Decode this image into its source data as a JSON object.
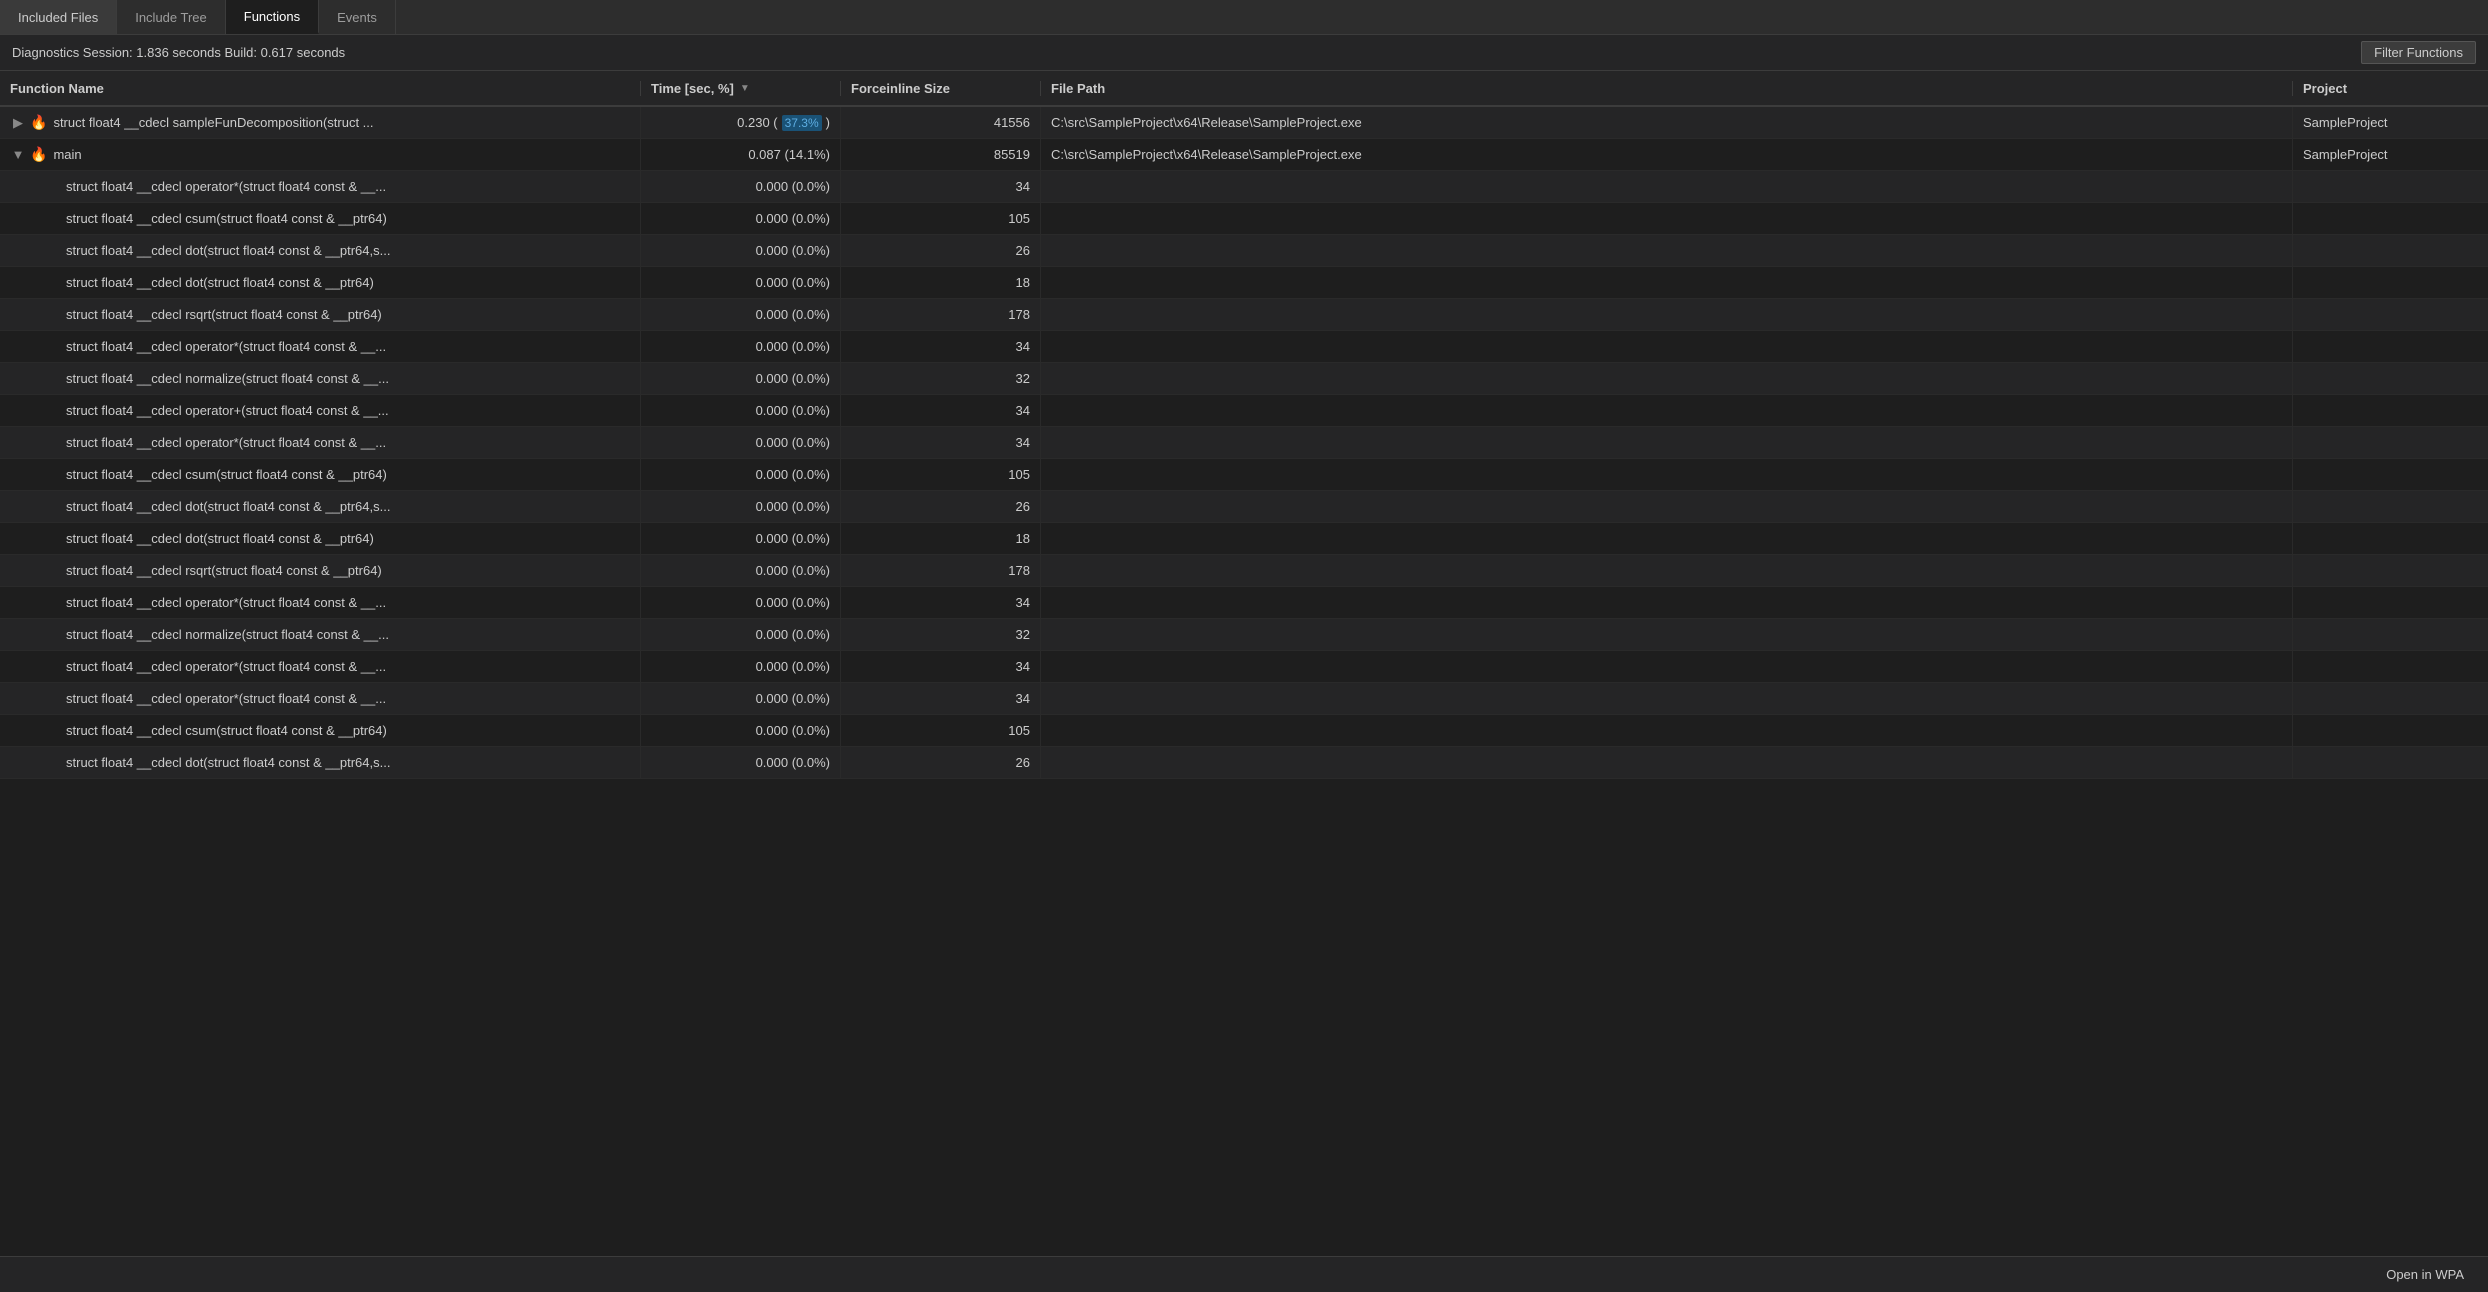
{
  "tabs": [
    {
      "id": "included-files",
      "label": "Included Files",
      "active": false
    },
    {
      "id": "include-tree",
      "label": "Include Tree",
      "active": false
    },
    {
      "id": "functions",
      "label": "Functions",
      "active": true
    },
    {
      "id": "events",
      "label": "Events",
      "active": false
    }
  ],
  "status": {
    "text": "Diagnostics Session: 1.836 seconds  Build: 0.617 seconds"
  },
  "filter_button_label": "Filter Functions",
  "columns": {
    "function_name": "Function Name",
    "time": "Time [sec, %]",
    "forceinline_size": "Forceinline Size",
    "file_path": "File Path",
    "project": "Project"
  },
  "rows": [
    {
      "level": 0,
      "expandable": true,
      "expanded": false,
      "has_flame": true,
      "indent": 0,
      "name": "struct float4 __cdecl sampleFunDecomposition(struct ...",
      "time_val": "0.230",
      "time_pct": "37.3%",
      "time_pct_highlight": true,
      "forceinline": "41556",
      "file_path": "C:\\src\\SampleProject\\x64\\Release\\SampleProject.exe",
      "project": "SampleProject"
    },
    {
      "level": 0,
      "expandable": true,
      "expanded": true,
      "has_flame": true,
      "indent": 0,
      "name": "main",
      "time_val": "0.087",
      "time_pct": "14.1%",
      "time_pct_highlight": false,
      "forceinline": "85519",
      "file_path": "C:\\src\\SampleProject\\x64\\Release\\SampleProject.exe",
      "project": "SampleProject"
    },
    {
      "level": 1,
      "expandable": false,
      "expanded": false,
      "has_flame": false,
      "indent": 36,
      "name": "struct float4 __cdecl operator*(struct float4 const & __...",
      "time_val": "0.000",
      "time_pct": "0.0%",
      "time_pct_highlight": false,
      "forceinline": "34",
      "file_path": "",
      "project": ""
    },
    {
      "level": 1,
      "expandable": false,
      "expanded": false,
      "has_flame": false,
      "indent": 36,
      "name": "struct float4 __cdecl csum(struct float4 const & __ptr64)",
      "time_val": "0.000",
      "time_pct": "0.0%",
      "time_pct_highlight": false,
      "forceinline": "105",
      "file_path": "",
      "project": ""
    },
    {
      "level": 1,
      "expandable": false,
      "expanded": false,
      "has_flame": false,
      "indent": 36,
      "name": "struct float4 __cdecl dot(struct float4 const & __ptr64,s...",
      "time_val": "0.000",
      "time_pct": "0.0%",
      "time_pct_highlight": false,
      "forceinline": "26",
      "file_path": "",
      "project": ""
    },
    {
      "level": 1,
      "expandable": false,
      "expanded": false,
      "has_flame": false,
      "indent": 36,
      "name": "struct float4 __cdecl dot(struct float4 const & __ptr64)",
      "time_val": "0.000",
      "time_pct": "0.0%",
      "time_pct_highlight": false,
      "forceinline": "18",
      "file_path": "",
      "project": ""
    },
    {
      "level": 1,
      "expandable": false,
      "expanded": false,
      "has_flame": false,
      "indent": 36,
      "name": "struct float4 __cdecl rsqrt(struct float4 const & __ptr64)",
      "time_val": "0.000",
      "time_pct": "0.0%",
      "time_pct_highlight": false,
      "forceinline": "178",
      "file_path": "",
      "project": ""
    },
    {
      "level": 1,
      "expandable": false,
      "expanded": false,
      "has_flame": false,
      "indent": 36,
      "name": "struct float4 __cdecl operator*(struct float4 const & __...",
      "time_val": "0.000",
      "time_pct": "0.0%",
      "time_pct_highlight": false,
      "forceinline": "34",
      "file_path": "",
      "project": ""
    },
    {
      "level": 1,
      "expandable": false,
      "expanded": false,
      "has_flame": false,
      "indent": 36,
      "name": "struct float4 __cdecl normalize(struct float4 const & __...",
      "time_val": "0.000",
      "time_pct": "0.0%",
      "time_pct_highlight": false,
      "forceinline": "32",
      "file_path": "",
      "project": ""
    },
    {
      "level": 1,
      "expandable": false,
      "expanded": false,
      "has_flame": false,
      "indent": 36,
      "name": "struct float4 __cdecl operator+(struct float4 const & __...",
      "time_val": "0.000",
      "time_pct": "0.0%",
      "time_pct_highlight": false,
      "forceinline": "34",
      "file_path": "",
      "project": ""
    },
    {
      "level": 1,
      "expandable": false,
      "expanded": false,
      "has_flame": false,
      "indent": 36,
      "name": "struct float4 __cdecl operator*(struct float4 const & __...",
      "time_val": "0.000",
      "time_pct": "0.0%",
      "time_pct_highlight": false,
      "forceinline": "34",
      "file_path": "",
      "project": ""
    },
    {
      "level": 1,
      "expandable": false,
      "expanded": false,
      "has_flame": false,
      "indent": 36,
      "name": "struct float4 __cdecl csum(struct float4 const & __ptr64)",
      "time_val": "0.000",
      "time_pct": "0.0%",
      "time_pct_highlight": false,
      "forceinline": "105",
      "file_path": "",
      "project": ""
    },
    {
      "level": 1,
      "expandable": false,
      "expanded": false,
      "has_flame": false,
      "indent": 36,
      "name": "struct float4 __cdecl dot(struct float4 const & __ptr64,s...",
      "time_val": "0.000",
      "time_pct": "0.0%",
      "time_pct_highlight": false,
      "forceinline": "26",
      "file_path": "",
      "project": ""
    },
    {
      "level": 1,
      "expandable": false,
      "expanded": false,
      "has_flame": false,
      "indent": 36,
      "name": "struct float4 __cdecl dot(struct float4 const & __ptr64)",
      "time_val": "0.000",
      "time_pct": "0.0%",
      "time_pct_highlight": false,
      "forceinline": "18",
      "file_path": "",
      "project": ""
    },
    {
      "level": 1,
      "expandable": false,
      "expanded": false,
      "has_flame": false,
      "indent": 36,
      "name": "struct float4 __cdecl rsqrt(struct float4 const & __ptr64)",
      "time_val": "0.000",
      "time_pct": "0.0%",
      "time_pct_highlight": false,
      "forceinline": "178",
      "file_path": "",
      "project": ""
    },
    {
      "level": 1,
      "expandable": false,
      "expanded": false,
      "has_flame": false,
      "indent": 36,
      "name": "struct float4 __cdecl operator*(struct float4 const & __...",
      "time_val": "0.000",
      "time_pct": "0.0%",
      "time_pct_highlight": false,
      "forceinline": "34",
      "file_path": "",
      "project": ""
    },
    {
      "level": 1,
      "expandable": false,
      "expanded": false,
      "has_flame": false,
      "indent": 36,
      "name": "struct float4 __cdecl normalize(struct float4 const & __...",
      "time_val": "0.000",
      "time_pct": "0.0%",
      "time_pct_highlight": false,
      "forceinline": "32",
      "file_path": "",
      "project": ""
    },
    {
      "level": 1,
      "expandable": false,
      "expanded": false,
      "has_flame": false,
      "indent": 36,
      "name": "struct float4 __cdecl operator*(struct float4 const & __...",
      "time_val": "0.000",
      "time_pct": "0.0%",
      "time_pct_highlight": false,
      "forceinline": "34",
      "file_path": "",
      "project": ""
    },
    {
      "level": 1,
      "expandable": false,
      "expanded": false,
      "has_flame": false,
      "indent": 36,
      "name": "struct float4 __cdecl operator*(struct float4 const & __...",
      "time_val": "0.000",
      "time_pct": "0.0%",
      "time_pct_highlight": false,
      "forceinline": "34",
      "file_path": "",
      "project": ""
    },
    {
      "level": 1,
      "expandable": false,
      "expanded": false,
      "has_flame": false,
      "indent": 36,
      "name": "struct float4 __cdecl csum(struct float4 const & __ptr64)",
      "time_val": "0.000",
      "time_pct": "0.0%",
      "time_pct_highlight": false,
      "forceinline": "105",
      "file_path": "",
      "project": ""
    },
    {
      "level": 1,
      "expandable": false,
      "expanded": false,
      "has_flame": false,
      "indent": 36,
      "name": "struct float4 __cdecl dot(struct float4 const & __ptr64,s...",
      "time_val": "0.000",
      "time_pct": "0.0%",
      "time_pct_highlight": false,
      "forceinline": "26",
      "file_path": "",
      "project": ""
    }
  ],
  "bottom_bar": {
    "open_wpa_label": "Open in WPA"
  },
  "colors": {
    "active_tab_bg": "#1e1e1e",
    "inactive_tab_bg": "#2d2d2d",
    "header_bg": "#252526",
    "row_bg_alt": "#252526",
    "row_bg": "#1e1e1e",
    "accent": "#1a5276",
    "pct_text": "#5dade2",
    "flame_color": "#e8613c"
  }
}
